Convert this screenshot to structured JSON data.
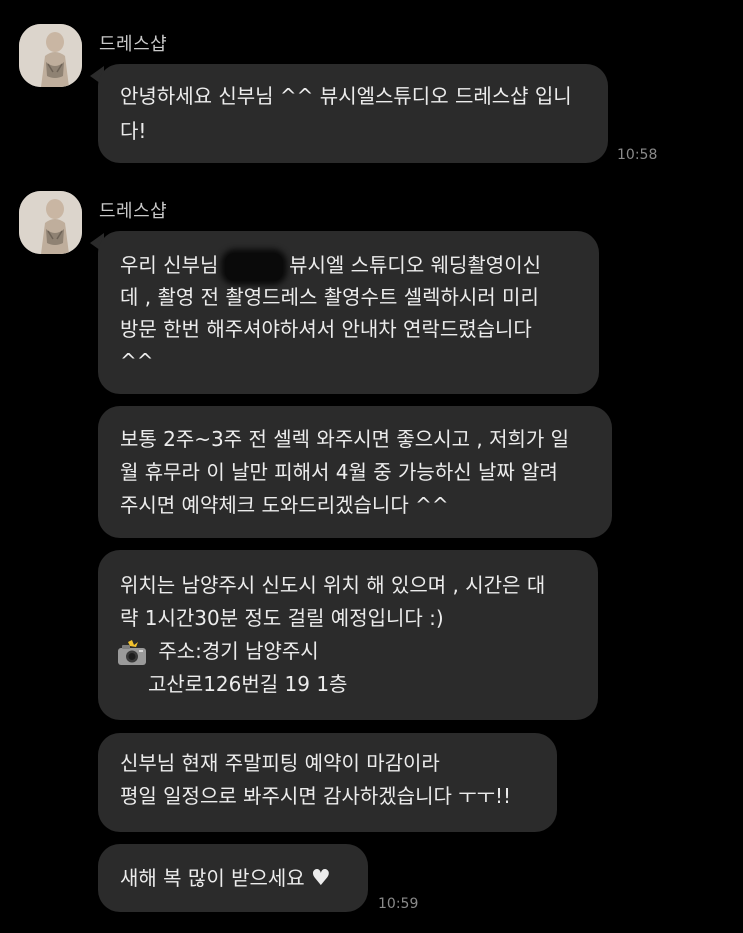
{
  "chat": {
    "sender_name": "드레스샵",
    "groups": [
      {
        "time": "10:58",
        "messages": [
          {
            "lines": [
              "안녕하세요 신부님 ^^ 뷰시엘스튜디오 드레스샵 입니",
              "다!"
            ]
          }
        ]
      },
      {
        "time": "10:59",
        "messages": [
          {
            "lines": [
              "우리 신부님",
              "뷰시엘 스튜디오 웨딩촬영이신",
              "데 , 촬영 전 촬영드레스 촬영수트 셀렉하시러 미리",
              "방문 한번 해주셔야하셔서 안내차 연락드렸습니다",
              "^^"
            ]
          },
          {
            "lines": [
              "보통 2주~3주 전 셀렉 와주시면 좋으시고 , 저희가 일",
              "월 휴무라 이 날만 피해서 4월 중 가능하신 날짜 알려",
              "주시면 예약체크 도와드리겠습니다 ^^"
            ]
          },
          {
            "lines": [
              "위치는 남양주시 신도시 위치 해 있으며 , 시간은 대",
              "략 1시간30분 정도 걸릴 예정입니다 :)",
              "주소:경기 남양주시",
              "고산로126번길 19 1층"
            ]
          },
          {
            "lines": [
              "신부님 현재 주말피팅 예약이 마감이라",
              "평일 일정으로 봐주시면 감사하겠습니다 ㅜㅜ!!"
            ]
          },
          {
            "lines": [
              "새해 복 많이 받으세요"
            ]
          }
        ]
      }
    ]
  }
}
